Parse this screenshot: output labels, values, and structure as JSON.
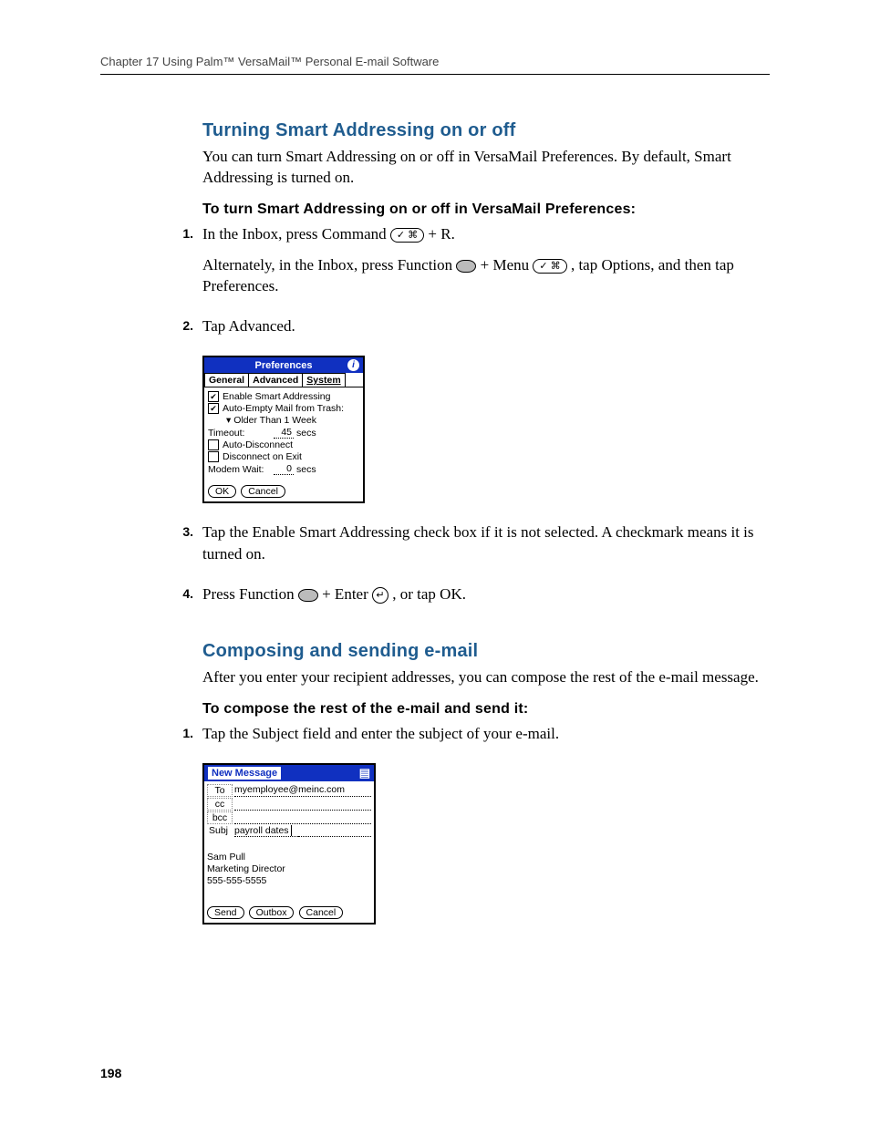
{
  "header": "Chapter 17   Using Palm™ VersaMail™ Personal E-mail Software",
  "section1": {
    "title": "Turning Smart Addressing on or off",
    "intro": "You can turn Smart Addressing on or off in VersaMail Preferences. By default, Smart Addressing is turned on.",
    "sub": "To turn Smart Addressing on or off in VersaMail Preferences:",
    "steps": {
      "s1n": "1.",
      "s1a_pre": "In the Inbox, press Command ",
      "s1a_post": " + R.",
      "s1b_pre": "Alternately, in the Inbox, press Function ",
      "s1b_mid": " + Menu ",
      "s1b_post": ", tap Options, and then tap Preferences.",
      "s2n": "2.",
      "s2": "Tap Advanced.",
      "s3n": "3.",
      "s3": "Tap the Enable Smart Addressing check box if it is not selected. A checkmark means it is turned on.",
      "s4n": "4.",
      "s4_pre": "Press Function ",
      "s4_mid": " + Enter ",
      "s4_post": ", or tap OK."
    }
  },
  "palm_prefs": {
    "title": "Preferences",
    "tabs": {
      "general": "General",
      "advanced": "Advanced",
      "system": "System"
    },
    "opt1": "Enable Smart Addressing",
    "opt2": "Auto-Empty Mail from Trash:",
    "opt2sub_arrow": "▾",
    "opt2sub": "Older Than 1 Week",
    "timeout_lbl": "Timeout:",
    "timeout_val": "45",
    "secs": "secs",
    "opt3": "Auto-Disconnect",
    "opt4": "Disconnect on Exit",
    "modem_lbl": "Modem Wait:",
    "modem_val": "0",
    "ok": "OK",
    "cancel": "Cancel"
  },
  "section2": {
    "title": "Composing and sending e-mail",
    "intro": "After you enter your recipient addresses, you can compose the rest of the e-mail message.",
    "sub": "To compose the rest of the e-mail and send it:",
    "s1n": "1.",
    "s1": "Tap the Subject field and enter the subject of your e-mail."
  },
  "palm_newmsg": {
    "title": "New Message",
    "to_lbl": "To",
    "to_val": "myemployee@meinc.com",
    "cc_lbl": "cc",
    "bcc_lbl": "bcc",
    "subj_lbl": "Subj",
    "subj_val": "payroll dates",
    "sig_name": "Sam Pull",
    "sig_title": "Marketing Director",
    "sig_phone": "555-555-5555",
    "send": "Send",
    "outbox": "Outbox",
    "cancel": "Cancel"
  },
  "icons": {
    "cmd": "✓ ⌘",
    "menu": "✓ ⌘",
    "enter": "↵"
  },
  "page_number": "198"
}
